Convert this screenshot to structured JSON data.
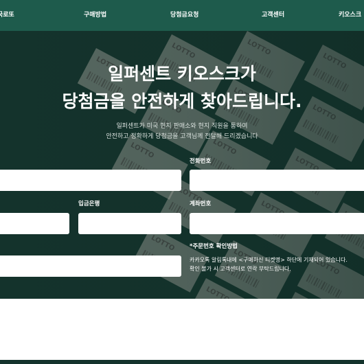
{
  "nav": {
    "items": [
      "국로또",
      "구매방법",
      "당첨금요청",
      "고객센터",
      "키오스크"
    ]
  },
  "hero": {
    "title_line1": "일퍼센트 키오스크가",
    "title_line2": "당첨금을 안전하게 찾아드립니다.",
    "subtitle_line1": "일퍼센트가 미국 현지 판매소와 현지 직원을 통하여",
    "subtitle_line2": "안전하고 정확하게 당첨금을 고객님께 전달해 드리겠습니다",
    "ticket_text": "LOTTO"
  },
  "form": {
    "phone_label": "전화번호",
    "bank_label": "입금은행",
    "account_label": "계좌번호",
    "order_label": "*주문번호 확인방법",
    "order_note_line1": "카카오톡 알림톡내에 <구매하신 티켓명> 하단에 기재되어 있습니다.",
    "order_note_line2": "확인 불가 시 고객센터로 연락 부탁드립니다."
  },
  "colors": {
    "nav_bg": "#1e5b4c",
    "hero_bg": "#14332c",
    "field_bg": "#ffffff"
  }
}
